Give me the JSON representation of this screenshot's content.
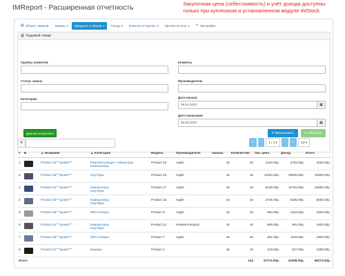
{
  "title": "IMReport - Расширенная отчетность",
  "promo": "Закупочная цена (себестоимость) и учёт дохода доступны только при купленном и установленном модуле IMStock",
  "tabs": [
    {
      "icon": "bar-chart-icon",
      "label": "Оборот заказов",
      "caret": false,
      "active": false
    },
    {
      "icon": "",
      "label": "Заказы",
      "caret": true,
      "active": false
    },
    {
      "icon": "",
      "label": "Продукты и Опции",
      "caret": true,
      "active": true
    },
    {
      "icon": "",
      "label": "Склад",
      "caret": true,
      "active": false
    },
    {
      "icon": "",
      "label": "Клиенты и Группы",
      "caret": true,
      "active": false
    },
    {
      "icon": "",
      "label": "Прочие отчеты",
      "caret": true,
      "active": false
    },
    {
      "icon": "wrench-icon",
      "label": "Настройки",
      "caret": false,
      "active": false
    }
  ],
  "filter": {
    "heading": "Ходовой товар",
    "customer_groups_label": "Группы клиентов",
    "customers_label": "Клиенты",
    "order_status_label": "Статус заказа",
    "manufacturer_label": "Производитель",
    "category_label": "Категория",
    "date_start_label": "Дата начала",
    "date_start_value": "09.04.2023",
    "date_end_label": "Дата окончания",
    "date_end_value": "09.06.2023",
    "data_received_button": "Данные получены!",
    "filter_button": "Фильтровать",
    "reset_button": "Сбросить"
  },
  "pager": {
    "first": "«",
    "prev": "‹",
    "page": "1 / 1",
    "next": "›",
    "last": "»",
    "per_page": "10"
  },
  "table": {
    "headers": [
      "#",
      "",
      "Название",
      "Категория",
      "Модель",
      "Производитель",
      "Заказы",
      "Количество",
      "Зак. цена",
      "Доход",
      "Итого"
    ],
    "rows": [
      {
        "n": "1",
        "thumb": "#222222",
        "name": "Product-42\"\"\"quotes\"\"\"",
        "category": [
          "Комплектующие > Мониторы",
          "Компьютеры"
        ],
        "model": "Product 15",
        "manufacturer": "Apple",
        "orders": "16",
        "qty": "32",
        "price": "1440.00р.",
        "income": "2752.00р.",
        "total": "4192.00р."
      },
      {
        "n": "2",
        "thumb": "#4a4f66",
        "name": "Product-45\"\"\"quotes\"\"\"",
        "category": [
          "Ноутбуки"
        ],
        "model": "Product 18",
        "manufacturer": "Apple",
        "orders": "16",
        "qty": "16",
        "price": "11194.00р.",
        "income": "29806.00р.",
        "total": "32800.00р."
      },
      {
        "n": "3",
        "thumb": "#3c4a7a",
        "name": "Product-44\"\"\"quotes\"\"\"",
        "category": [
          "Компьютеры",
          "Ноутбуки"
        ],
        "model": "Product 17",
        "manufacturer": "Apple",
        "orders": "16",
        "qty": "16",
        "price": "5248.00р.",
        "income": "10752.00р.",
        "total": "16000.00р."
      },
      {
        "n": "4",
        "thumb": "#5d6a88",
        "name": "Product-43\"\"\"quotes\"\"\"",
        "category": [
          "Компьютеры",
          "Ноутбуки"
        ],
        "model": "Product 16",
        "manufacturer": "Apple",
        "orders": "16",
        "qty": "16",
        "price": "2745.00р.",
        "income": "5255.00р.",
        "total": "8000.00р."
      },
      {
        "n": "5",
        "thumb": "#9a9a9a",
        "name": "Product-36\"\"\"quotes\"\"\"",
        "category": [
          "MP3 плееры"
        ],
        "model": "Product 9",
        "manufacturer": "Apple",
        "orders": "16",
        "qty": "16",
        "price": "584.00р.",
        "income": "1016.00р.",
        "total": "1600.00р."
      },
      {
        "n": "6",
        "thumb": "#555555",
        "name": "Product-41\"\"\"quotes\"\"\"",
        "category": [
          "Компьютеры",
          "Ноутбуки"
        ],
        "model": "Product 21",
        "manufacturer": "Hewlett-Packard",
        "orders": "16",
        "qty": "16",
        "price": "609.00р.",
        "income": "991.00р.",
        "total": "1600.00р."
      },
      {
        "n": "7",
        "thumb": "#6a7a9a",
        "name": "Product-34\"\"\"quotes\"\"\"",
        "category": [
          "MP3 плееры"
        ],
        "model": "Product 7",
        "manufacturer": "Apple",
        "orders": "16",
        "qty": "16",
        "price": "461.00р.",
        "income": "1139.00р.",
        "total": "1600.00р."
      },
      {
        "n": "8",
        "thumb": "#1a1a1a",
        "name": "Product-31\"\"\"quotes\"\"\"",
        "category": [
          "Камеры"
        ],
        "model": "Product 4",
        "manufacturer": "",
        "orders": "16",
        "qty": "16",
        "price": "443.00р.",
        "income": "837.00р.",
        "total": "1280.00р."
      }
    ],
    "total_label": "Итого",
    "total_qty": "144",
    "total_price": "22774.00р.",
    "total_income": "43498.00р.",
    "total_total": "66272.00р."
  }
}
